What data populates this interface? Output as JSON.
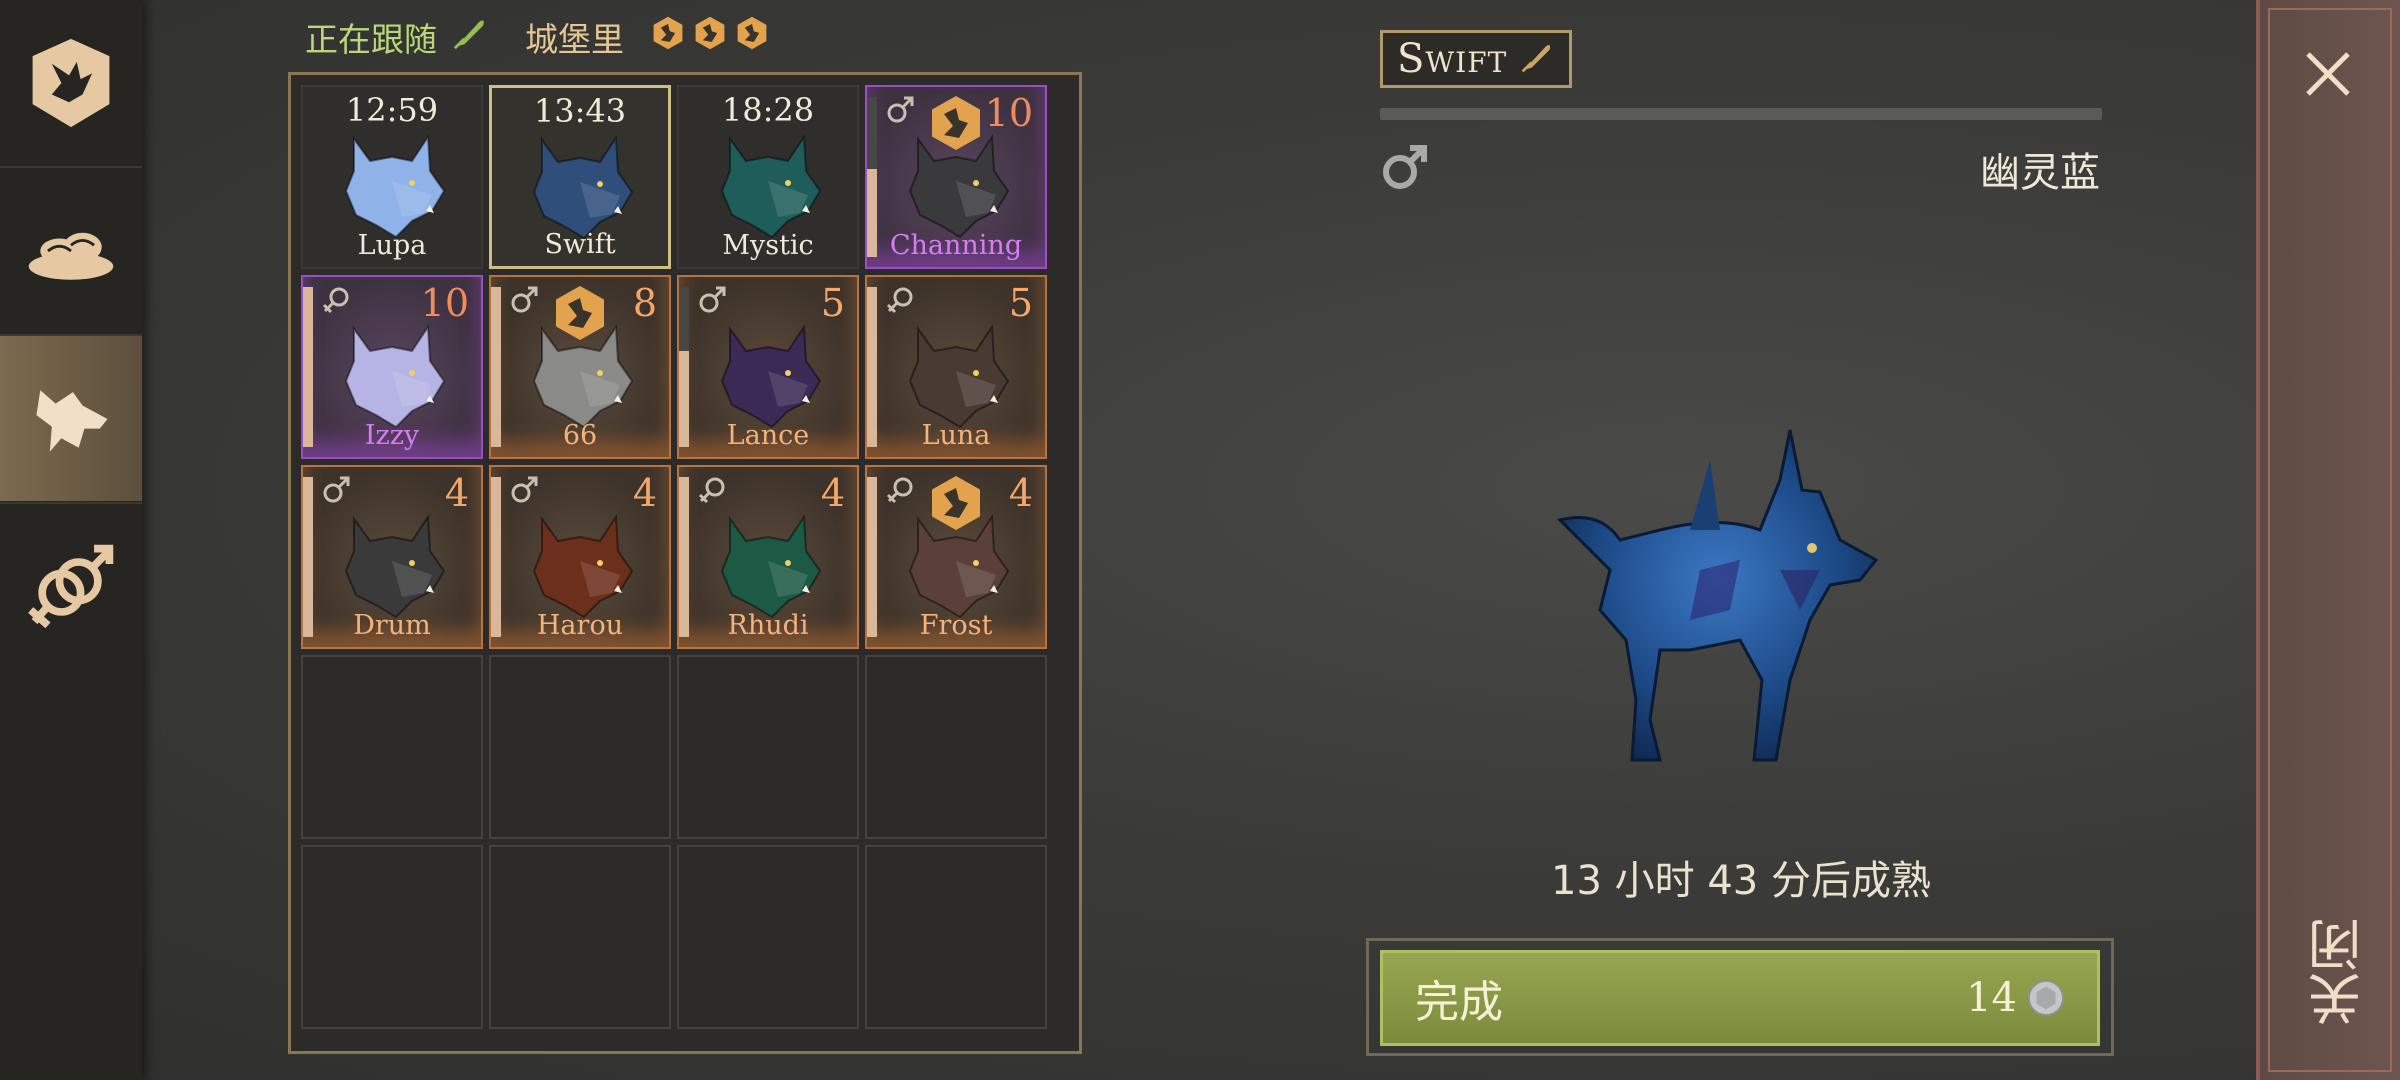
{
  "colors": {
    "accent_gold": "#cfbf82",
    "orange_rarity": "#b8743f",
    "purple_rarity": "#9b4ec3",
    "button_green": "#8a9a46",
    "follow_green": "#b8d87a"
  },
  "nav": [
    {
      "icon": "wolf-crest-icon",
      "active": false
    },
    {
      "icon": "food-bowl-icon",
      "active": false
    },
    {
      "icon": "wolf-head-icon",
      "active": true
    },
    {
      "icon": "breeding-gender-icon",
      "active": false
    }
  ],
  "header": {
    "following_label": "正在跟随",
    "following_icon": "feather-icon",
    "castle_label": "城堡里",
    "castle_pips_icon": "paw-badge-icon",
    "castle_pips": 3
  },
  "grid": {
    "columns": 4,
    "rows": 5,
    "pets": [
      {
        "name": "Lupa",
        "time": "12:59",
        "rarity": "plain",
        "fur": "#8fb2e8"
      },
      {
        "name": "Swift",
        "time": "13:43",
        "rarity": "plain",
        "fur": "#2f4f7a",
        "selected": true
      },
      {
        "name": "Mystic",
        "time": "18:28",
        "rarity": "plain",
        "fur": "#1f5d5a"
      },
      {
        "name": "Channing",
        "level": "10",
        "sex": "male",
        "rarity": "purple",
        "fur": "#3a3a3c",
        "badge": true,
        "growth": 0.55
      },
      {
        "name": "Izzy",
        "level": "10",
        "sex": "female",
        "rarity": "purple",
        "fur": "#b6b4e4",
        "growth": 1.0
      },
      {
        "name": "66",
        "level": "8",
        "sex": "male",
        "rarity": "orange",
        "fur": "#8a8a88",
        "badge": true,
        "growth": 1.0
      },
      {
        "name": "Lance",
        "level": "5",
        "sex": "male",
        "rarity": "orange",
        "fur": "#3a2a55",
        "growth": 0.6
      },
      {
        "name": "Luna",
        "level": "5",
        "sex": "female",
        "rarity": "orange",
        "fur": "#4a3a34",
        "growth": 1.0
      },
      {
        "name": "Drum",
        "level": "4",
        "sex": "male",
        "rarity": "orange",
        "fur": "#3a3a3a",
        "growth": 1.0
      },
      {
        "name": "Harou",
        "level": "4",
        "sex": "male",
        "rarity": "orange",
        "fur": "#6b2f1c",
        "growth": 1.0
      },
      {
        "name": "Rhudi",
        "level": "4",
        "sex": "female",
        "rarity": "orange",
        "fur": "#1d5a45",
        "growth": 1.0
      },
      {
        "name": "Frost",
        "level": "4",
        "sex": "female",
        "rarity": "orange",
        "fur": "#5a4038",
        "badge": true,
        "growth": 1.0
      }
    ]
  },
  "detail": {
    "name": "Swift",
    "name_icon": "feather-icon",
    "growth_progress": 0.0,
    "sex": "male",
    "variant": "幽灵蓝",
    "maturity_text": "13 小时 43 分后成熟",
    "fur": "#1f4f8a"
  },
  "complete_button": {
    "label": "完成",
    "cost": "14",
    "currency_icon": "silver-coin-icon"
  },
  "close": {
    "label": "关闭",
    "icon": "close-icon"
  }
}
